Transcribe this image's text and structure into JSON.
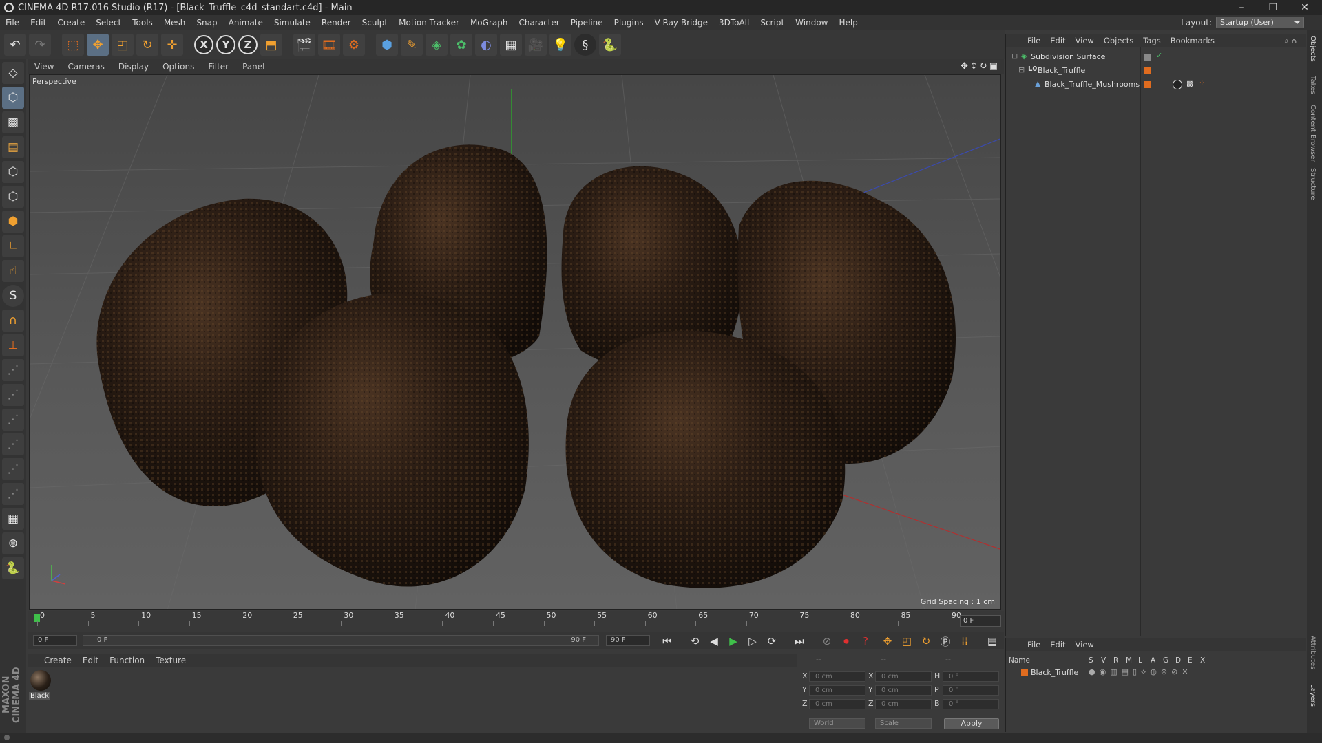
{
  "window": {
    "title": "CINEMA 4D R17.016 Studio (R17) - [Black_Truffle_c4d_standart.c4d] - Main"
  },
  "menu": [
    "File",
    "Edit",
    "Create",
    "Select",
    "Tools",
    "Mesh",
    "Snap",
    "Animate",
    "Simulate",
    "Render",
    "Sculpt",
    "Motion Tracker",
    "MoGraph",
    "Character",
    "Pipeline",
    "Plugins",
    "V-Ray Bridge",
    "3DToAll",
    "Script",
    "Window",
    "Help"
  ],
  "layout": {
    "label": "Layout:",
    "value": "Startup (User)"
  },
  "viewport": {
    "menu": [
      "View",
      "Cameras",
      "Display",
      "Options",
      "Filter",
      "Panel"
    ],
    "camera_label": "Perspective",
    "grid_spacing": "Grid Spacing : 1 cm"
  },
  "timeline": {
    "ticks": [
      "0",
      "5",
      "10",
      "15",
      "20",
      "25",
      "30",
      "35",
      "40",
      "45",
      "50",
      "55",
      "60",
      "65",
      "70",
      "75",
      "80",
      "85",
      "90"
    ],
    "current_frame_right": "0 F",
    "start_field": "0 F",
    "range_start": "0 F",
    "range_end": "90 F",
    "end_field": "90 F"
  },
  "material_manager": {
    "menu": [
      "Create",
      "Edit",
      "Function",
      "Texture"
    ],
    "material_name": "Black"
  },
  "coordinates": {
    "headers": [
      "--",
      "--",
      "--"
    ],
    "rows": [
      {
        "l1": "X",
        "v1": "0 cm",
        "l2": "X",
        "v2": "0 cm",
        "l3": "H",
        "v3": "0 °"
      },
      {
        "l1": "Y",
        "v1": "0 cm",
        "l2": "Y",
        "v2": "0 cm",
        "l3": "P",
        "v3": "0 °"
      },
      {
        "l1": "Z",
        "v1": "0 cm",
        "l2": "Z",
        "v2": "0 cm",
        "l3": "B",
        "v3": "0 °"
      }
    ],
    "space_dropdown": "World",
    "mode_dropdown": "Scale",
    "apply_label": "Apply"
  },
  "object_manager": {
    "menu": [
      "File",
      "Edit",
      "View",
      "Objects",
      "Tags",
      "Bookmarks"
    ],
    "objects": [
      {
        "name": "Subdivision Surface",
        "icon": "subdivision-icon"
      },
      {
        "name": "Black_Truffle",
        "icon": "null-object-icon"
      },
      {
        "name": "Black_Truffle_Mushrooms",
        "icon": "polygon-object-icon"
      }
    ]
  },
  "layer_manager": {
    "menu": [
      "File",
      "Edit",
      "View"
    ],
    "columns": [
      "Name",
      "S",
      "V",
      "R",
      "M",
      "L",
      "A",
      "G",
      "D",
      "E",
      "X"
    ],
    "layer_name": "Black_Truffle"
  },
  "right_tabs": [
    "Objects",
    "Takes",
    "Content Browser",
    "Structure",
    "Attributes",
    "Layers"
  ],
  "brand": "MAXON CINEMA 4D",
  "colors": {
    "accent_orange": "#e06c1f",
    "selected_blue": "#5b6f84"
  }
}
